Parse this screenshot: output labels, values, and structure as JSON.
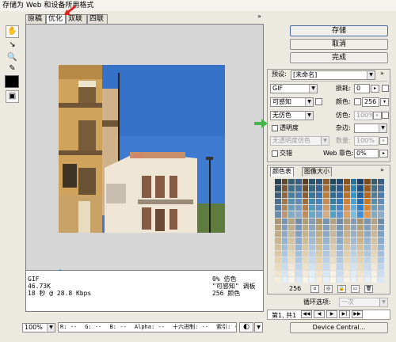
{
  "window": {
    "title": "存储为 Web 和设备所用格式"
  },
  "tabs": [
    {
      "label": "原稿"
    },
    {
      "label": "优化"
    },
    {
      "label": "双联"
    },
    {
      "label": "四联"
    }
  ],
  "actions": {
    "save": "存储",
    "cancel": "取消",
    "done": "完成"
  },
  "settings": {
    "preset_label": "预设:",
    "preset_value": "[未命名]",
    "format": "GIF",
    "reduction": "可感知",
    "dither_algo": "无仿色",
    "transparency_label": "透明度",
    "transparency_dither": "无透明度仿色",
    "interlaced_label": "交错",
    "lossy_label": "损耗:",
    "lossy_value": "0",
    "colors_label": "颜色:",
    "colors_value": "256",
    "dither_label": "仿色:",
    "dither_value": "100%",
    "matte_label": "杂边:",
    "amount_label": "数量:",
    "amount_value": "100%",
    "web_snap_label": "Web 靠色:",
    "web_snap_value": "0%"
  },
  "color_table": {
    "tab_color": "颜色表",
    "tab_image_size": "图像大小",
    "count": "256"
  },
  "info": {
    "format": "GIF",
    "size": "46.73K",
    "time": "18 秒 @ 28.8 Kbps",
    "dither_pct": "0% 仿色",
    "palette": "\"可感知\" 调板",
    "colors": "256 颜色"
  },
  "animation": {
    "loop_label": "循环选项:",
    "loop_value": "一次",
    "frame_info": "第1, 共1"
  },
  "footer": {
    "zoom": "100%",
    "r": "R: --",
    "g": "G: --",
    "b": "B: --",
    "alpha": "Alpha: --",
    "hex": "十六进制: --",
    "index": "索引: --",
    "device_central": "Device Central..."
  },
  "colors": {
    "arrow_red": "#e3231b",
    "arrow_blue": "#2a74c9",
    "arrow_green": "#43b649",
    "sky": "#3e7ccc"
  },
  "icons": [
    "hand-tool-icon",
    "slice-select-tool-icon",
    "zoom-tool-icon",
    "eyedropper-tool-icon",
    "eyedropper-color-swatch",
    "toggle-slices-icon"
  ]
}
